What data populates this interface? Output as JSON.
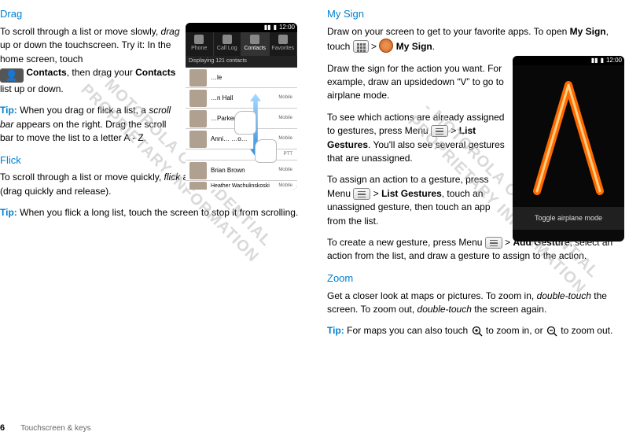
{
  "left": {
    "drag": {
      "heading": "Drag",
      "p1a": "To scroll through a list or move slowly, ",
      "p1b": " up or down the touchscreen. Try it: In the home screen, touch ",
      "contacts_label": "Contacts",
      "p1c": ", then drag your ",
      "p1d": " list up or down.",
      "tip_label": "Tip:",
      "tip1a": " When you drag or flick a list, a ",
      "scrollbar_i": "scroll bar",
      "tip1b": " appears on the right. Drag the scroll bar to move the list to a letter A - Z.",
      "drag_i": "drag"
    },
    "flick": {
      "heading": "Flick",
      "p1a": "To scroll through a list or move quickly, ",
      "flick_i": "flick",
      "p1b": " across the touchscreen (drag quickly and release).",
      "tip_label": "Tip:",
      "tip1": " When you flick a long list, touch the screen to stop it from scrolling."
    },
    "phone": {
      "time": "12:00",
      "tabs": [
        "Phone",
        "Call Log",
        "Contacts",
        "Favorites"
      ],
      "displaying": "Displaying 121 contacts",
      "rows": [
        {
          "name": "…le",
          "tag": ""
        },
        {
          "name": "…n Hall",
          "tag": "Mobile"
        },
        {
          "name": "…Parker",
          "tag": "Mobile"
        },
        {
          "name": "Anni…    …o…",
          "tag": "Mobile"
        },
        {
          "name": "",
          "tag": "PTT"
        },
        {
          "name": "Brian Brown",
          "tag": "Mobile"
        },
        {
          "name": "Heather Wachulinskoski",
          "tag": "Mobile"
        }
      ]
    }
  },
  "right": {
    "mysign": {
      "heading": "My Sign",
      "p1a": "Draw on your screen to get to your favorite apps. To open ",
      "mysign_b": "My Sign",
      "p1b": ", touch ",
      "gt": ">",
      "p1c": ".",
      "p2": "Draw the sign for the action you want. For example, draw an upsidedown “V” to go to airplane mode.",
      "p3a": "To see which actions are already assigned to gestures, press Menu ",
      "lg_b": "List Gestures",
      "p3b": ". You'll also see several gestures that are unassigned.",
      "p4a": "To assign an action to a gesture, press Menu ",
      "list_b": "List Gestures",
      "p4b": ", touch an unassigned gesture, then touch an app from the list.",
      "p5a": "To create a new gesture, press Menu ",
      "add_b": "Add Gesture",
      "p5b": ", select an action from the list, and draw a gesture to assign to the action."
    },
    "zoom": {
      "heading": "Zoom",
      "p1a": "Get a closer look at maps or pictures. To zoom in, ",
      "dt_i": "double-touch",
      "p1b": " the screen. To zoom out, ",
      "p1c": " the screen again.",
      "tip_label": "Tip:",
      "tip1a": " For maps you can also touch ",
      "tip1b": " to zoom in, or ",
      "tip1c": " to zoom out."
    },
    "phone": {
      "time": "12:00",
      "toggle": "Toggle airplane mode"
    }
  },
  "watermark": "- MOTOROLA CONFIDENTIAL\nPROPRIETARY INFORMATION",
  "footer": {
    "page": "6",
    "section": "Touchscreen & keys"
  }
}
